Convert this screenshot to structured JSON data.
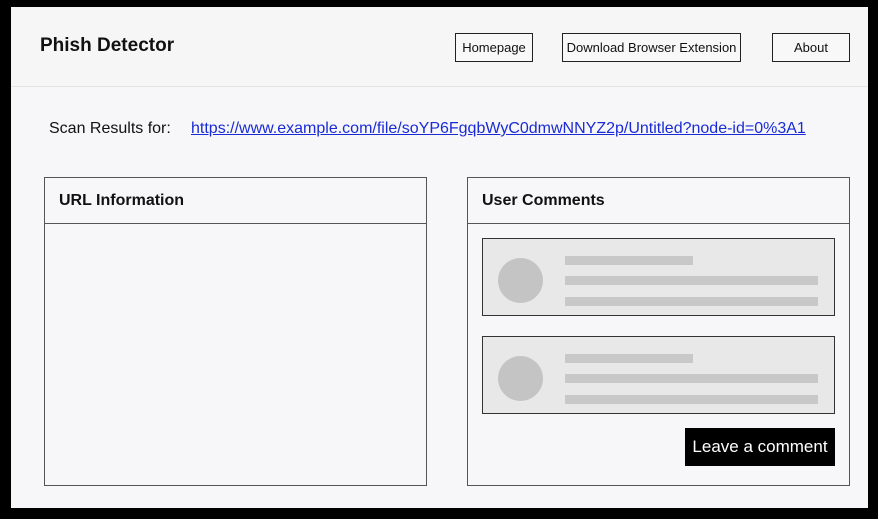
{
  "app": {
    "title": "Phish Detector"
  },
  "nav": {
    "homepage": "Homepage",
    "download_extension": "Download Browser Extension",
    "about": "About"
  },
  "scan": {
    "label": "Scan Results for:",
    "url": "https://www.example.com/file/soYP6FgqbWyC0dmwNNYZ2p/Untitled?node-id=0%3A1"
  },
  "url_info": {
    "title": "URL Information"
  },
  "comments": {
    "title": "User Comments",
    "leave_comment_label": "Leave a comment"
  },
  "colors": {
    "link": "#1a2bd6",
    "placeholder": "#c8c8c8",
    "button_bg": "#000000"
  }
}
